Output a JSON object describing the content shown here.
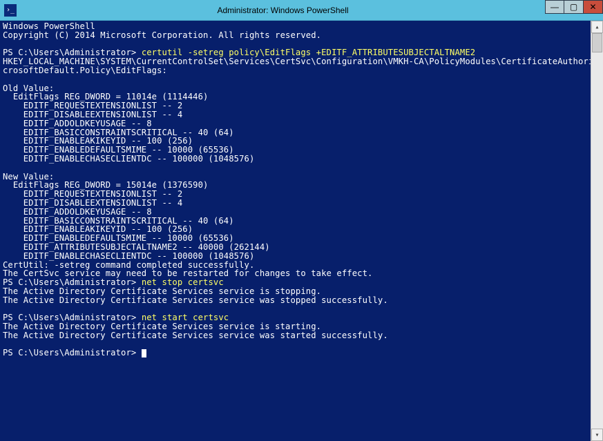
{
  "window": {
    "title": "Administrator: Windows PowerShell",
    "controls": {
      "minimize": "—",
      "maximize": "▢",
      "close": "✕"
    }
  },
  "prompt_prefix": "PS C:\\Users\\Administrator> ",
  "lines": {
    "l00": "Windows PowerShell",
    "l01": "Copyright (C) 2014 Microsoft Corporation. All rights reserved.",
    "l02": "",
    "l03_prompt": "PS C:\\Users\\Administrator> ",
    "l03_cmd": "certutil -setreg policy\\EditFlags +EDITF_ATTRIBUTESUBJECTALTNAME2",
    "l04": "HKEY_LOCAL_MACHINE\\SYSTEM\\CurrentControlSet\\Services\\CertSvc\\Configuration\\VMKH-CA\\PolicyModules\\CertificateAuthority_Mi",
    "l05": "crosoftDefault.Policy\\EditFlags:",
    "l06": "",
    "l07": "Old Value:",
    "l08": "  EditFlags REG_DWORD = 11014e (1114446)",
    "l09": "    EDITF_REQUESTEXTENSIONLIST -- 2",
    "l10": "    EDITF_DISABLEEXTENSIONLIST -- 4",
    "l11": "    EDITF_ADDOLDKEYUSAGE -- 8",
    "l12": "    EDITF_BASICCONSTRAINTSCRITICAL -- 40 (64)",
    "l13": "    EDITF_ENABLEAKIKEYID -- 100 (256)",
    "l14": "    EDITF_ENABLEDEFAULTSMIME -- 10000 (65536)",
    "l15": "    EDITF_ENABLECHASECLIENTDC -- 100000 (1048576)",
    "l16": "",
    "l17": "New Value:",
    "l18": "  EditFlags REG_DWORD = 15014e (1376590)",
    "l19": "    EDITF_REQUESTEXTENSIONLIST -- 2",
    "l20": "    EDITF_DISABLEEXTENSIONLIST -- 4",
    "l21": "    EDITF_ADDOLDKEYUSAGE -- 8",
    "l22": "    EDITF_BASICCONSTRAINTSCRITICAL -- 40 (64)",
    "l23": "    EDITF_ENABLEAKIKEYID -- 100 (256)",
    "l24": "    EDITF_ENABLEDEFAULTSMIME -- 10000 (65536)",
    "l25": "    EDITF_ATTRIBUTESUBJECTALTNAME2 -- 40000 (262144)",
    "l26": "    EDITF_ENABLECHASECLIENTDC -- 100000 (1048576)",
    "l27": "CertUtil: -setreg command completed successfully.",
    "l28": "The CertSvc service may need to be restarted for changes to take effect.",
    "l29_prompt": "PS C:\\Users\\Administrator> ",
    "l29_cmd": "net stop certsvc",
    "l30": "The Active Directory Certificate Services service is stopping.",
    "l31": "The Active Directory Certificate Services service was stopped successfully.",
    "l32": "",
    "l33_prompt": "PS C:\\Users\\Administrator> ",
    "l33_cmd": "net start certsvc",
    "l34": "The Active Directory Certificate Services service is starting.",
    "l35": "The Active Directory Certificate Services service was started successfully.",
    "l36": "",
    "l37_prompt": "PS C:\\Users\\Administrator> "
  },
  "scrollbar": {
    "up": "▴",
    "down": "▾"
  }
}
